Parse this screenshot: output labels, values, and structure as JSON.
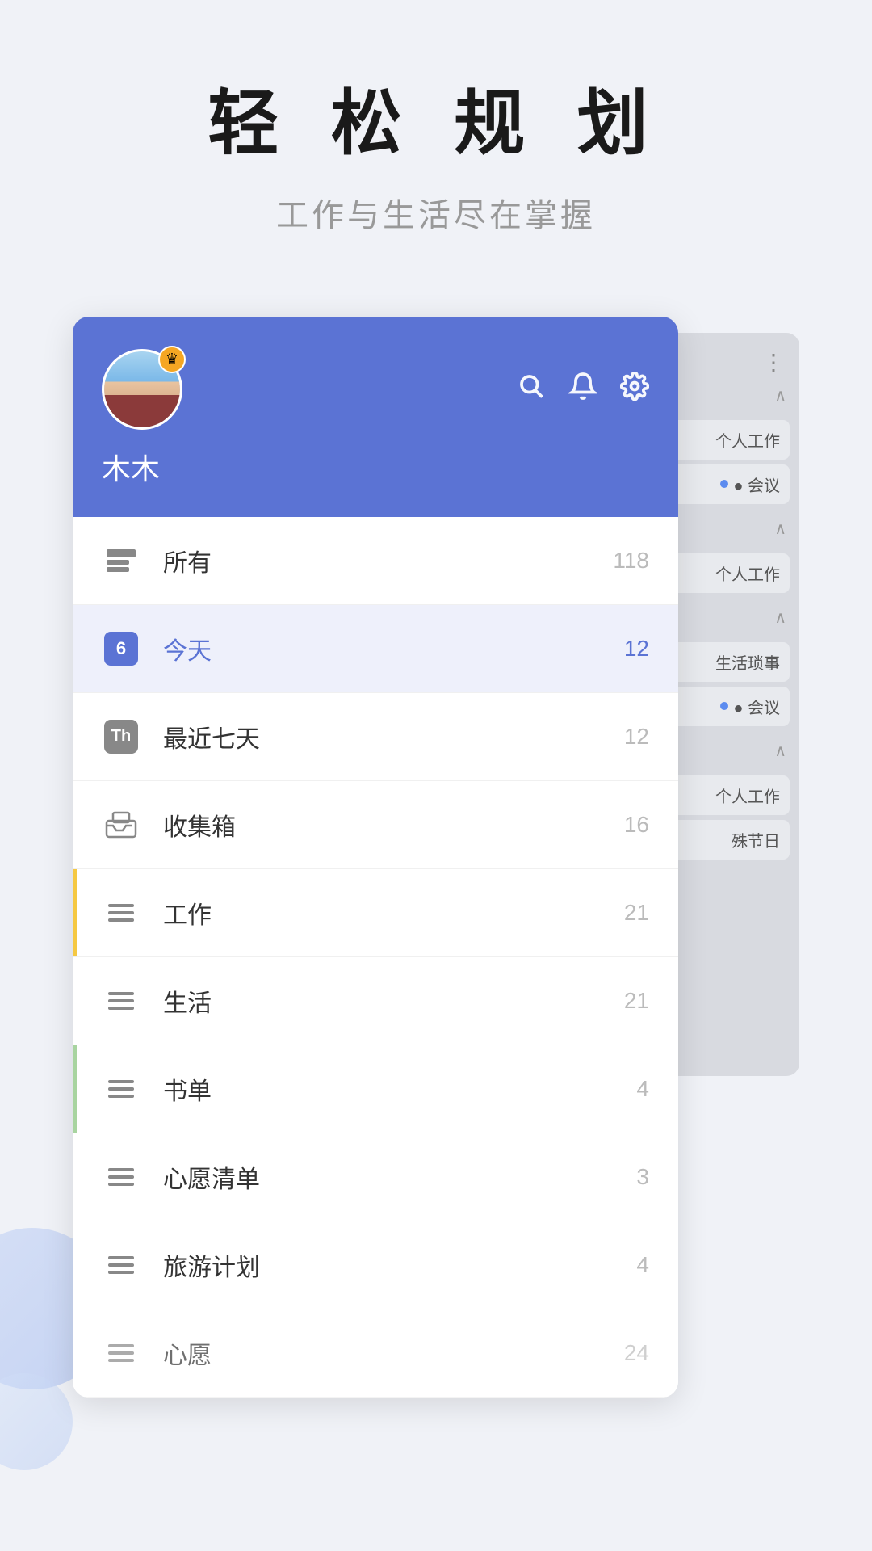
{
  "hero": {
    "title": "轻 松 规 划",
    "subtitle": "工作与生活尽在掌握"
  },
  "header": {
    "username": "木木",
    "crown_icon": "👑",
    "search_label": "搜索",
    "bell_label": "通知",
    "settings_label": "设置",
    "more_label": "更多"
  },
  "menu_items": [
    {
      "id": "all",
      "label": "所有",
      "count": "118",
      "icon_type": "stack",
      "active": false
    },
    {
      "id": "today",
      "label": "今天",
      "count": "12",
      "icon_type": "calendar",
      "active": true
    },
    {
      "id": "week",
      "label": "最近七天",
      "count": "12",
      "icon_type": "th",
      "active": false
    },
    {
      "id": "inbox",
      "label": "收集箱",
      "count": "16",
      "icon_type": "inbox",
      "active": false
    },
    {
      "id": "work",
      "label": "工作",
      "count": "21",
      "icon_type": "lines",
      "active": false
    },
    {
      "id": "life",
      "label": "生活",
      "count": "21",
      "icon_type": "lines",
      "active": false
    },
    {
      "id": "books",
      "label": "书单",
      "count": "4",
      "icon_type": "lines",
      "active": false
    },
    {
      "id": "wishes",
      "label": "心愿清单",
      "count": "3",
      "icon_type": "lines",
      "active": false
    },
    {
      "id": "travel",
      "label": "旅游计划",
      "count": "4",
      "icon_type": "lines",
      "active": false
    },
    {
      "id": "more",
      "label": "心愿",
      "count": "24",
      "icon_type": "lines",
      "active": false
    }
  ],
  "bg_panel": {
    "items": [
      {
        "text": "个人工作",
        "has_dot": false
      },
      {
        "text": "会议",
        "has_dot": true
      },
      {
        "text": "个人工作",
        "has_dot": false
      },
      {
        "text": "生活琐事",
        "has_dot": false
      },
      {
        "text": "会议",
        "has_dot": true
      },
      {
        "text": "个人工作",
        "has_dot": false
      },
      {
        "text": "殊节日",
        "has_dot": false
      }
    ]
  },
  "calendar_number": "6",
  "th_text": "Th",
  "colors": {
    "primary": "#5b73d4",
    "active_bg": "#eef0fb",
    "header_bg": "#5b73d4"
  }
}
